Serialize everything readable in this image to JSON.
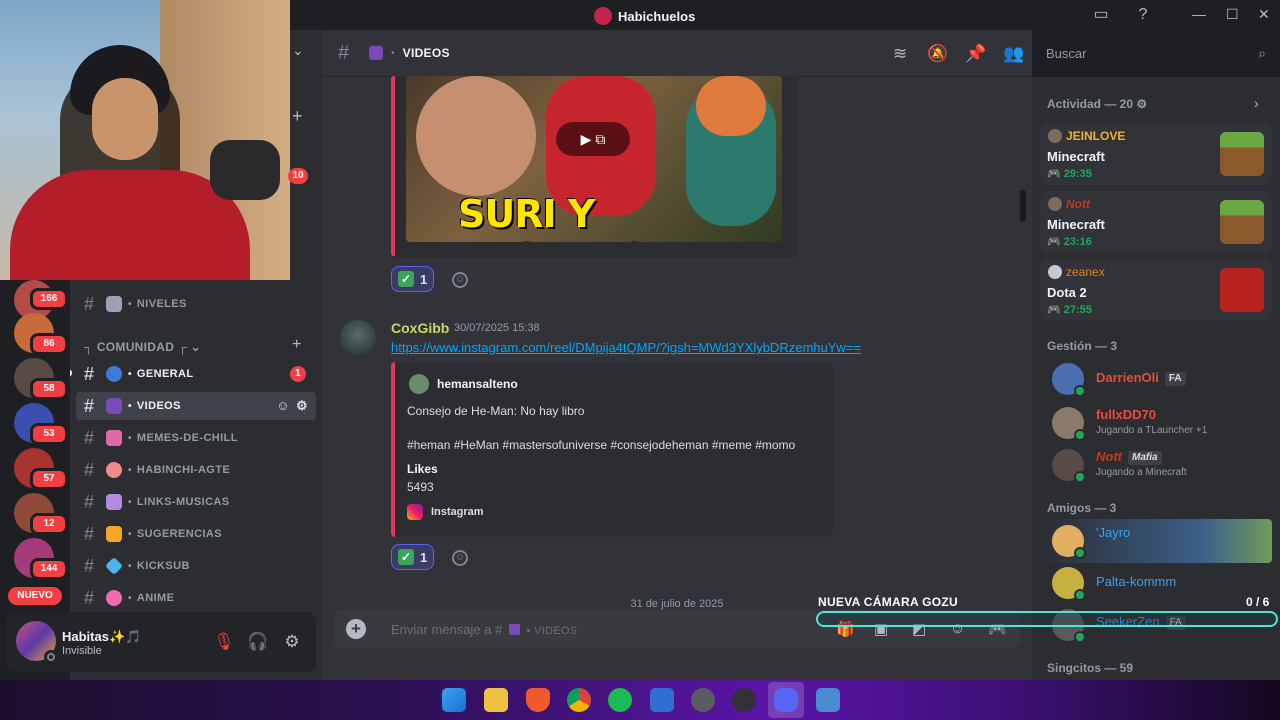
{
  "window": {
    "title": "Habichuelos"
  },
  "webcam": {
    "badge": "10"
  },
  "servers": [
    {
      "badge": "166",
      "color": "#b54a48"
    },
    {
      "badge": "86",
      "color": "#c86a3a"
    },
    {
      "badge": "58",
      "color": "#5a4a46"
    },
    {
      "badge": "53",
      "color": "#3c4fb0"
    },
    {
      "badge": "57",
      "color": "#a8322e"
    },
    {
      "badge": "12",
      "color": "#8f4a3a"
    },
    {
      "badge": "144",
      "color": "#a43b7a"
    }
  ],
  "nuevo_label": "NUEVO",
  "sidebar": {
    "category": "COMUNIDAD",
    "channels": [
      {
        "name": "NIVELES",
        "emoji_color": "#9aa3b5"
      },
      {
        "name": "GENERAL",
        "emoji_color": "#3e7bd6",
        "mention": "1"
      },
      {
        "name": "VIDEOS",
        "emoji_color": "#7a4bb6"
      },
      {
        "name": "MEMES-DE-CHILL",
        "emoji_color": "#e06aa8"
      },
      {
        "name": "HABINCHI-AGTE",
        "emoji_color": "#f08a8a"
      },
      {
        "name": "LINKS-MUSICAS",
        "emoji_color": "#b38ae0"
      },
      {
        "name": "SUGERENCIAS",
        "emoji_color": "#f5a623"
      },
      {
        "name": "KICKSUB",
        "emoji_color": "#4ab3f0"
      },
      {
        "name": "ANIME",
        "emoji_color": "#f06ab0"
      }
    ]
  },
  "user_panel": {
    "name": "Habitas✨🎵",
    "status": "Invisible"
  },
  "channel_header": {
    "name": "VIDEOS",
    "search_placeholder": "Buscar"
  },
  "first_embed": {
    "caption": "SURI Y LAGARTO",
    "reaction_count": "1"
  },
  "message": {
    "author": "CoxGibb",
    "timestamp": "30/07/2025 15:38",
    "link": "https://www.instagram.com/reel/DMpija4tQMP/?igsh=MWd3YXlybDRzemhuYw==",
    "embed": {
      "author": "hemansalteno",
      "desc_line1": "Consejo de He-Man: No hay libro",
      "desc_line2": "#heman #HeMan #mastersofuniverse #consejodeheman #meme #momo",
      "field_name": "Likes",
      "field_value": "5493",
      "footer": "Instagram"
    },
    "reaction_count": "1"
  },
  "date_divider": "31 de julio de 2025",
  "composer": {
    "placeholder_prefix": "Enviar mensaje a #",
    "placeholder_channel": "VIDEOS"
  },
  "right_panel": {
    "activity_title": "Actividad — 20",
    "activities": [
      {
        "user": "JEINLOVE",
        "user_color": "#f0b232",
        "game": "Minecraft",
        "time": "29:35",
        "thumb": "#5d9b3a"
      },
      {
        "user": "Nott",
        "user_color": "#c0392b",
        "game": "Minecraft",
        "time": "23:16",
        "thumb": "#5d9b3a"
      },
      {
        "user": "zeanex",
        "user_color": "#e67e22",
        "game": "Dota 2",
        "time": "27:55",
        "thumb": "#b8231f"
      }
    ],
    "gestion_title": "Gestión — 3",
    "gestion": [
      {
        "name": "DarrienOli",
        "color": "#e74c3c",
        "tag": "FA",
        "sub": "",
        "avatar": "#4a6fb0"
      },
      {
        "name": "fullxDD70",
        "color": "#e74c3c",
        "tag": "",
        "sub": "Jugando a TLauncher +1",
        "avatar": "#8a7a6a"
      },
      {
        "name": "Nott",
        "color": "#c0392b",
        "tag": "Mafia",
        "sub": "Jugando a Minecraft",
        "avatar": "#5a4a46"
      }
    ],
    "amigos_title": "Amigos — 3",
    "amigos": [
      {
        "name": "'Jayro",
        "color": "#3aa0f0",
        "avatar": "#e0b060"
      },
      {
        "name": "Palta-kommm",
        "color": "#3aa0f0",
        "avatar": "#c8b040"
      },
      {
        "name": "SeekerZen",
        "color": "#3aa0f0",
        "tag": "FA",
        "avatar": "#5a5a5a"
      }
    ],
    "singcitos_title": "Singcitos — 59"
  },
  "overlay": {
    "title": "NUEVA CÁMARA GOZU",
    "count": "0 / 6"
  }
}
